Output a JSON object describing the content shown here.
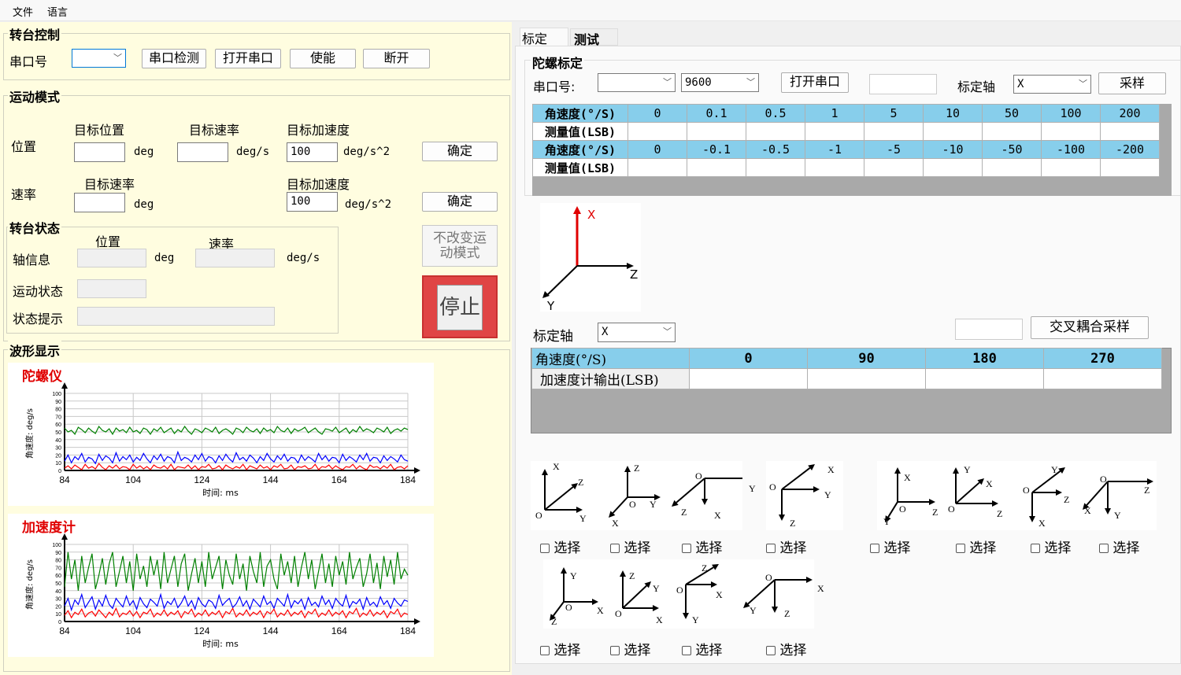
{
  "menu": {
    "file": "文件",
    "language": "语言"
  },
  "turntable": {
    "title": "转台控制",
    "port_label": "串口号",
    "detect": "串口检测",
    "open": "打开串口",
    "enable": "使能",
    "disconnect": "断开"
  },
  "motion": {
    "title": "运动模式",
    "position": "位置",
    "target_pos": "目标位置",
    "target_rate": "目标速率",
    "target_acc": "目标加速度",
    "deg": "deg",
    "degs": "deg/s",
    "degs2": "deg/s^2",
    "acc_value": "100",
    "confirm": "确定",
    "rate": "速率",
    "acc_value2": "100",
    "confirm2": "确定"
  },
  "status": {
    "title": "转台状态",
    "pos": "位置",
    "rate": "速率",
    "axis_info": "轴信息",
    "deg": "deg",
    "degs": "deg/s",
    "motion_state": "运动状态",
    "hint": "状态提示",
    "no_change": "不改变运动模式",
    "stop": "停止"
  },
  "wave": {
    "title": "波形显示",
    "gyro": "陀螺仪",
    "acc": "加速度计",
    "ylabel": "角速度: deg/s",
    "xlabel": "时间: ms"
  },
  "chart_data": [
    {
      "type": "line",
      "title": "陀螺仪",
      "xlabel": "时间: ms",
      "ylabel": "角速度: deg/s",
      "xlim": [
        84,
        184
      ],
      "ylim": [
        0,
        100
      ],
      "xticks": [
        84,
        104,
        124,
        144,
        164,
        184
      ],
      "yticks": [
        0,
        10,
        20,
        30,
        40,
        50,
        60,
        70,
        80,
        90,
        100
      ],
      "grid": true,
      "series": [
        {
          "color": "#008000",
          "values": [
            55,
            50,
            52,
            47,
            56,
            53,
            49,
            55,
            51,
            48,
            57,
            52,
            50,
            54,
            47,
            55,
            51,
            53,
            49,
            56,
            50,
            52,
            48,
            55,
            53,
            47,
            54,
            51,
            56,
            49,
            52,
            55,
            48,
            53,
            50,
            57,
            51,
            47,
            54,
            52,
            49,
            55,
            53,
            50,
            56,
            48,
            52,
            54,
            51,
            47,
            55,
            53,
            49,
            56,
            52,
            50,
            54,
            48,
            55,
            51,
            53,
            49,
            57,
            52,
            50,
            55,
            48,
            54,
            51,
            53,
            56,
            49,
            52,
            55,
            50,
            47,
            54,
            53,
            51,
            56,
            49,
            52,
            55,
            48,
            53,
            50,
            57,
            51,
            54,
            52,
            49,
            55,
            53,
            50,
            56,
            48,
            52,
            54,
            51,
            55,
            53
          ]
        },
        {
          "color": "#0000ff",
          "values": [
            12,
            20,
            10,
            18,
            14,
            22,
            11,
            17,
            15,
            9,
            21,
            13,
            19,
            16,
            10,
            23,
            12,
            18,
            14,
            20,
            11,
            17,
            13,
            22,
            15,
            10,
            19,
            14,
            21,
            12,
            18,
            16,
            10,
            24,
            13,
            17,
            15,
            11,
            20,
            14,
            22,
            12,
            18,
            16,
            10,
            19,
            13,
            21,
            15,
            11,
            23,
            14,
            17,
            12,
            20,
            16,
            10,
            18,
            13,
            22,
            15,
            11,
            19,
            14,
            21,
            12,
            17,
            16,
            10,
            20,
            13,
            18,
            15,
            11,
            22,
            14,
            19,
            12,
            17,
            16,
            10,
            21,
            13,
            18,
            15,
            11,
            20,
            14,
            22,
            12,
            17,
            16,
            10,
            19,
            13,
            18,
            15,
            11,
            20,
            14,
            12
          ]
        },
        {
          "color": "#ff0000",
          "values": [
            3,
            6,
            2,
            7,
            4,
            1,
            8,
            3,
            5,
            2,
            9,
            4,
            1,
            6,
            3,
            7,
            2,
            5,
            4,
            1,
            8,
            3,
            6,
            2,
            5,
            1,
            7,
            4,
            3,
            6,
            2,
            8,
            1,
            5,
            4,
            3,
            7,
            2,
            6,
            1,
            5,
            4,
            8,
            2,
            3,
            6,
            1,
            7,
            4,
            2,
            5,
            3,
            8,
            1,
            6,
            4,
            2,
            7,
            3,
            5,
            1,
            6,
            4,
            8,
            2,
            3,
            7,
            1,
            5,
            4,
            6,
            2,
            3,
            8,
            1,
            5,
            4,
            7,
            2,
            6,
            3,
            1,
            5,
            4,
            8,
            2,
            6,
            3,
            1,
            7,
            4,
            5,
            2,
            6,
            3,
            8,
            1,
            4,
            5,
            2,
            6
          ]
        }
      ]
    },
    {
      "type": "line",
      "title": "加速度计",
      "xlabel": "时间: ms",
      "ylabel": "角速度: deg/s",
      "xlim": [
        84,
        184
      ],
      "ylim": [
        0,
        100
      ],
      "xticks": [
        84,
        104,
        124,
        144,
        164,
        184
      ],
      "yticks": [
        0,
        10,
        20,
        30,
        40,
        50,
        60,
        70,
        80,
        90,
        100
      ],
      "grid": true,
      "series": [
        {
          "color": "#008000",
          "values": [
            45,
            90,
            55,
            80,
            40,
            85,
            50,
            70,
            88,
            42,
            60,
            82,
            48,
            75,
            90,
            45,
            65,
            85,
            50,
            78,
            40,
            88,
            55,
            72,
            45,
            85,
            60,
            80,
            42,
            90,
            50,
            68,
            85,
            45,
            75,
            88,
            40,
            62,
            82,
            50,
            78,
            45,
            90,
            55,
            70,
            85,
            42,
            80,
            60,
            48,
            88,
            55,
            75,
            40,
            85,
            65,
            50,
            90,
            45,
            72,
            80,
            55,
            42,
            88,
            60,
            78,
            50,
            85,
            45,
            70,
            90,
            55,
            80,
            42,
            65,
            88,
            50,
            75,
            45,
            85,
            60,
            78,
            48,
            90,
            55,
            70,
            82,
            45,
            62,
            88,
            50,
            76,
            42,
            85,
            58,
            80,
            48,
            90,
            55,
            68,
            60
          ]
        },
        {
          "color": "#0000ff",
          "values": [
            20,
            30,
            15,
            28,
            22,
            35,
            18,
            25,
            32,
            16,
            28,
            20,
            34,
            22,
            17,
            30,
            24,
            19,
            33,
            21,
            27,
            16,
            31,
            23,
            18,
            29,
            25,
            20,
            35,
            17,
            26,
            22,
            30,
            18,
            24,
            33,
            20,
            27,
            16,
            31,
            23,
            19,
            28,
            25,
            17,
            34,
            21,
            26,
            30,
            18,
            23,
            32,
            20,
            27,
            16,
            29,
            24,
            19,
            33,
            22,
            26,
            17,
            30,
            25,
            20,
            35,
            18,
            27,
            23,
            29,
            16,
            31,
            21,
            25,
            19,
            33,
            22,
            28,
            17,
            30,
            24,
            20,
            34,
            18,
            26,
            23,
            29,
            16,
            31,
            21,
            25,
            19,
            32,
            22,
            27,
            17,
            30,
            24,
            20,
            28,
            26
          ]
        },
        {
          "color": "#ff0000",
          "values": [
            8,
            14,
            5,
            12,
            9,
            16,
            6,
            11,
            13,
            7,
            15,
            10,
            5,
            12,
            8,
            17,
            6,
            11,
            9,
            14,
            7,
            13,
            5,
            12,
            10,
            16,
            6,
            11,
            8,
            15,
            7,
            12,
            9,
            14,
            5,
            13,
            10,
            16,
            6,
            11,
            8,
            15,
            7,
            12,
            9,
            14,
            5,
            13,
            10,
            17,
            6,
            11,
            8,
            15,
            7,
            12,
            9,
            14,
            5,
            13,
            10,
            16,
            6,
            11,
            8,
            15,
            7,
            12,
            9,
            14,
            5,
            13,
            10,
            16,
            6,
            11,
            8,
            15,
            7,
            12,
            9,
            14,
            5,
            13,
            10,
            17,
            6,
            11,
            8,
            15,
            7,
            12,
            9,
            14,
            5,
            13,
            10,
            16,
            6,
            11,
            9
          ]
        }
      ]
    }
  ],
  "tabs": {
    "calibrate": "标定",
    "test": "测试"
  },
  "gyro_cal": {
    "title": "陀螺标定",
    "port_label": "串口号:",
    "baud": "9600",
    "open": "打开串口",
    "axis_label": "标定轴",
    "axis": "X",
    "sample": "采样",
    "row1_label": "角速度(°/S)",
    "row1": [
      "0",
      "0.1",
      "0.5",
      "1",
      "5",
      "10",
      "50",
      "100",
      "200"
    ],
    "row2_label": "测量值(LSB)",
    "row3_label": "角速度(°/S)",
    "row3": [
      "0",
      "-0.1",
      "-0.5",
      "-1",
      "-5",
      "-10",
      "-50",
      "-100",
      "-200"
    ],
    "row4_label": "测量值(LSB)"
  },
  "axis_fig": {
    "x": "X",
    "y": "Y",
    "z": "Z"
  },
  "cross": {
    "axis_label": "标定轴",
    "axis": "X",
    "sample": "交叉耦合采样",
    "head_label": "角速度(°/S)",
    "angles": [
      "0",
      "90",
      "180",
      "270"
    ],
    "out_label": "加速度计输出(LSB)"
  },
  "orient": {
    "select": "选择",
    "o": "O"
  }
}
